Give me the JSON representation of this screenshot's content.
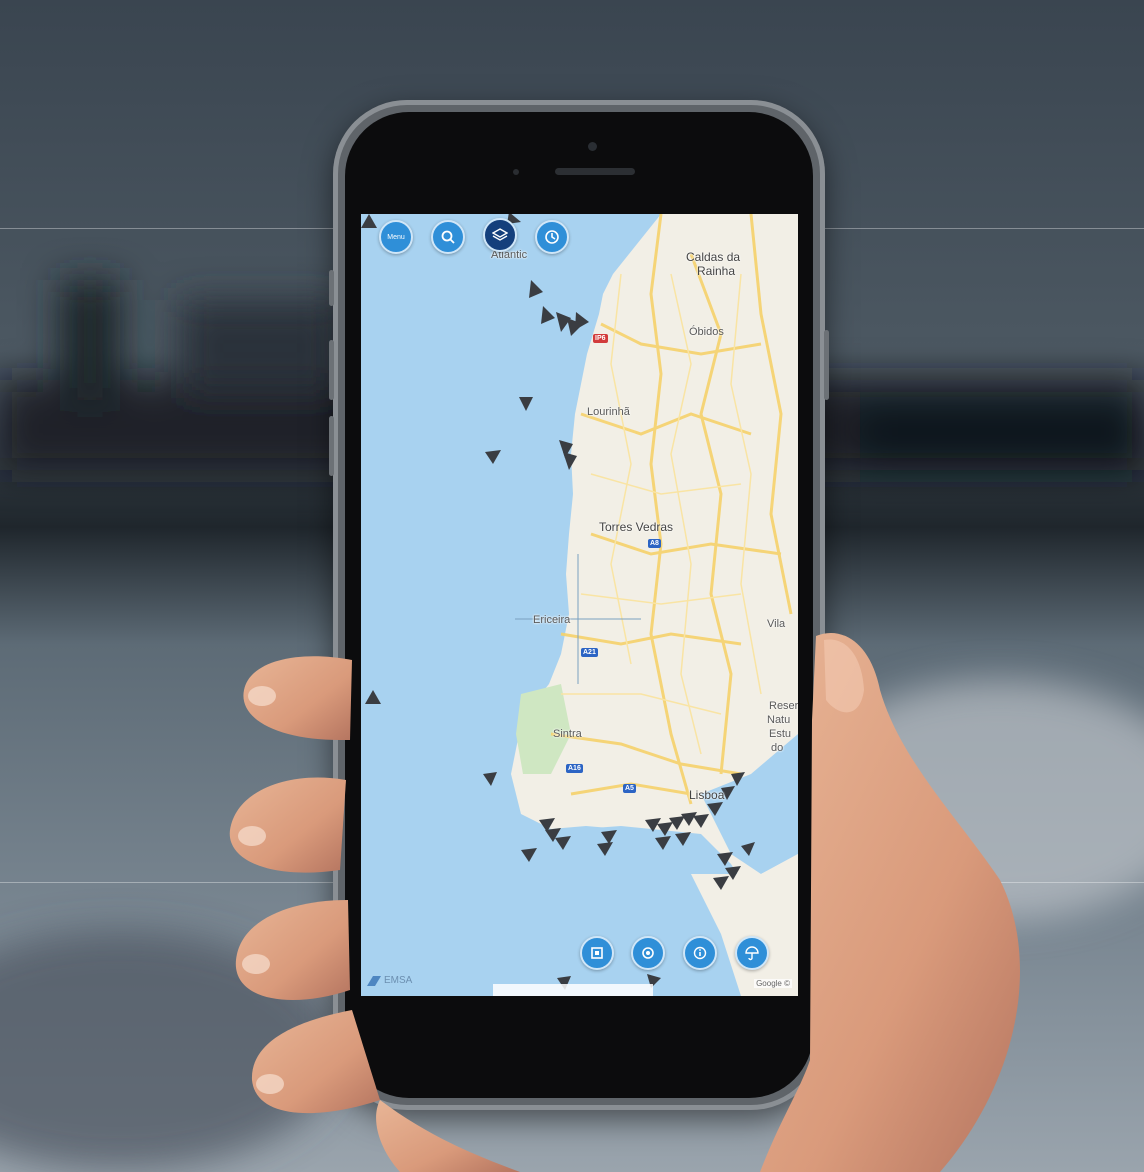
{
  "toolbar": {
    "menu_label": "Menu",
    "search_icon": "search-icon",
    "layers_icon": "layers-icon",
    "history_icon": "clock-icon"
  },
  "map": {
    "labels": {
      "caldas": "Caldas da",
      "rainha": "Rainha",
      "obidos": "Óbidos",
      "lourinha": "Lourinhã",
      "torres": "Torres Vedras",
      "ericeira": "Ericeira",
      "sintra": "Sintra",
      "lisboa": "Lisboa",
      "vila": "Vila",
      "reserva": "Reser",
      "natural": "Natu",
      "estuario": "Estu",
      "do": "do",
      "atlantic": "Atlantic"
    },
    "shields": {
      "a8": "A8",
      "a21": "A21",
      "a16": "A16",
      "a5": "A5",
      "ip6": "IP6"
    }
  },
  "bottom_controls": {
    "fit_icon": "fit-bounds-icon",
    "locate_icon": "locate-icon",
    "info_icon": "info-icon",
    "weather_icon": "umbrella-icon"
  },
  "footer": {
    "brand": "EMSA",
    "attribution": "Google ©"
  }
}
